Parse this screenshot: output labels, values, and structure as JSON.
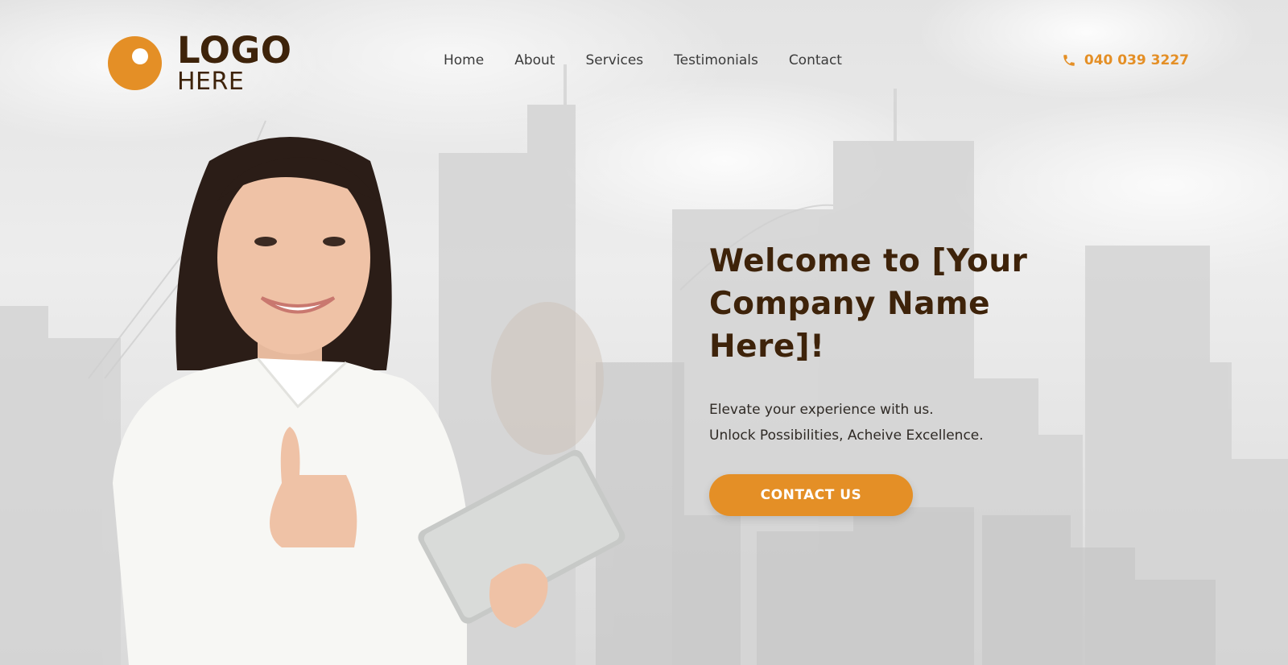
{
  "brand": {
    "logo_line1": "LOGO",
    "logo_line2": "HERE",
    "accent": "#e48f26",
    "dark": "#3e230a"
  },
  "nav": {
    "items": [
      "Home",
      "About",
      "Services",
      "Testimonials",
      "Contact"
    ]
  },
  "header": {
    "phone": "040 039 3227",
    "phone_icon": "phone-icon"
  },
  "hero": {
    "headline": "Welcome to [Your Company Name Here]!",
    "sub_line1": "Elevate your experience with us.",
    "sub_line2": "Unlock Possibilities, Acheive Excellence.",
    "cta_label": "CONTACT US"
  }
}
